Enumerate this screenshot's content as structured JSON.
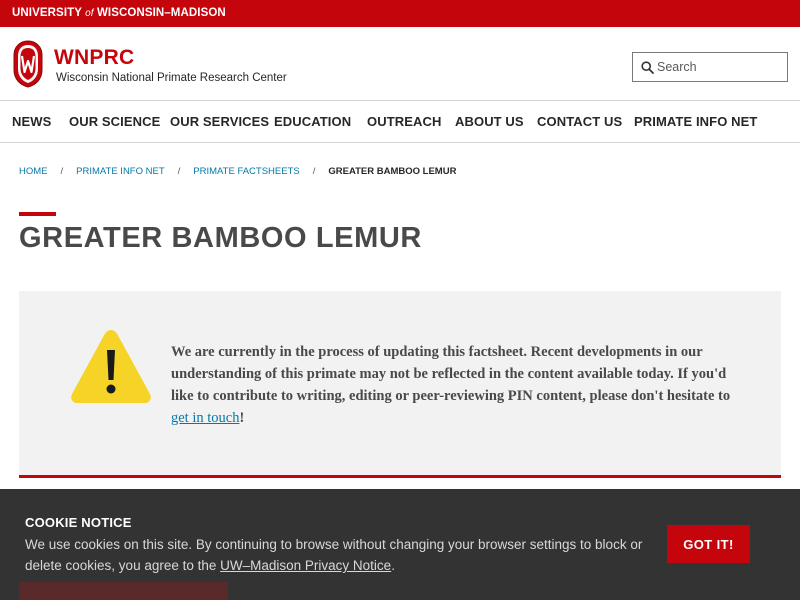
{
  "topbar": {
    "part1": "UNIVERSITY ",
    "of": "of",
    "part2": " WISCONSIN–MADISON"
  },
  "header": {
    "brand": "WNPRC",
    "subtitle": "Wisconsin National Primate Research Center",
    "search_placeholder": "Search"
  },
  "nav": {
    "items": [
      "NEWS",
      "OUR SCIENCE",
      "OUR SERVICES",
      "EDUCATION",
      "OUTREACH",
      "ABOUT US",
      "CONTACT US",
      "PRIMATE INFO NET"
    ]
  },
  "breadcrumb": {
    "home": "HOME",
    "pin": "PRIMATE INFO NET",
    "factsheets": "PRIMATE FACTSHEETS",
    "current": "GREATER BAMBOO LEMUR",
    "separator": "/"
  },
  "page": {
    "title": "GREATER BAMBOO LEMUR"
  },
  "notice": {
    "text": "We are currently in the process of updating this factsheet. Recent developments in our understanding of this primate may not be reflected in the content available today. If you'd like to contribute to writing, editing or peer-reviewing PIN content, please don't hesitate to ",
    "link": "get in touch",
    "end": "!"
  },
  "cookie": {
    "title": "COOKIE NOTICE",
    "text": "We use cookies on this site. By continuing to browse without changing your browser settings to block or delete cookies, you agree to the ",
    "link": "UW–Madison Privacy Notice",
    "end": ".",
    "button": "GOT IT!"
  },
  "colors": {
    "brand_red": "#c5050c",
    "link_blue": "#0479a8",
    "warning_yellow": "#f5d327",
    "cookie_bg": "#333333"
  }
}
